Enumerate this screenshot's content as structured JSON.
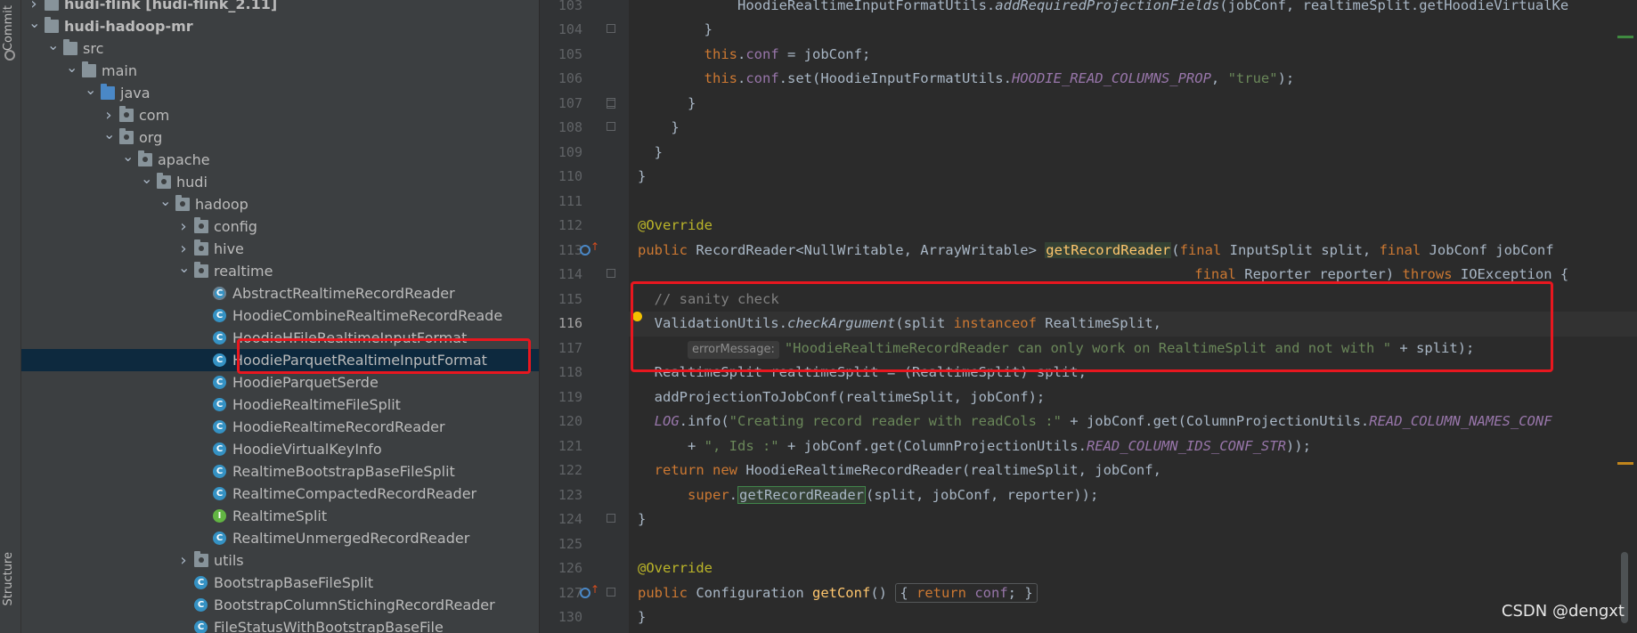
{
  "toolstrip": {
    "commit_label": "Commit",
    "structure_label": "Structure"
  },
  "tree": {
    "rows": [
      {
        "label": "hudi-flink [hudi-flink_2.11]",
        "kind": "module",
        "depth": 1,
        "arrow": ">"
      },
      {
        "label": "hudi-hadoop-mr",
        "kind": "module",
        "depth": 1,
        "arrow": "v"
      },
      {
        "label": "src",
        "kind": "folder",
        "depth": 2,
        "arrow": "v"
      },
      {
        "label": "main",
        "kind": "folder",
        "depth": 3,
        "arrow": "v"
      },
      {
        "label": "java",
        "kind": "source",
        "depth": 4,
        "arrow": "v"
      },
      {
        "label": "com",
        "kind": "package",
        "depth": 5,
        "arrow": ">"
      },
      {
        "label": "org",
        "kind": "package",
        "depth": 5,
        "arrow": "v"
      },
      {
        "label": "apache",
        "kind": "package",
        "depth": 6,
        "arrow": "v"
      },
      {
        "label": "hudi",
        "kind": "package",
        "depth": 7,
        "arrow": "v"
      },
      {
        "label": "hadoop",
        "kind": "package",
        "depth": 8,
        "arrow": "v"
      },
      {
        "label": "config",
        "kind": "package",
        "depth": 9,
        "arrow": ">"
      },
      {
        "label": "hive",
        "kind": "package",
        "depth": 9,
        "arrow": ">"
      },
      {
        "label": "realtime",
        "kind": "package",
        "depth": 9,
        "arrow": "v"
      },
      {
        "label": "AbstractRealtimeRecordReader",
        "kind": "abstract",
        "depth": 10,
        "arrow": ""
      },
      {
        "label": "HoodieCombineRealtimeRecordReade",
        "kind": "class",
        "depth": 10,
        "arrow": ""
      },
      {
        "label": "HoodieHFileRealtimeInputFormat",
        "kind": "class",
        "depth": 10,
        "arrow": ""
      },
      {
        "label": "HoodieParquetRealtimeInputFormat",
        "kind": "class",
        "depth": 10,
        "arrow": "",
        "selected": true
      },
      {
        "label": "HoodieParquetSerde",
        "kind": "class",
        "depth": 10,
        "arrow": ""
      },
      {
        "label": "HoodieRealtimeFileSplit",
        "kind": "class",
        "depth": 10,
        "arrow": ""
      },
      {
        "label": "HoodieRealtimeRecordReader",
        "kind": "class",
        "depth": 10,
        "arrow": ""
      },
      {
        "label": "HoodieVirtualKeyInfo",
        "kind": "class",
        "depth": 10,
        "arrow": ""
      },
      {
        "label": "RealtimeBootstrapBaseFileSplit",
        "kind": "class",
        "depth": 10,
        "arrow": ""
      },
      {
        "label": "RealtimeCompactedRecordReader",
        "kind": "class",
        "depth": 10,
        "arrow": ""
      },
      {
        "label": "RealtimeSplit",
        "kind": "interface",
        "depth": 10,
        "arrow": ""
      },
      {
        "label": "RealtimeUnmergedRecordReader",
        "kind": "class",
        "depth": 10,
        "arrow": ""
      },
      {
        "label": "utils",
        "kind": "package",
        "depth": 9,
        "arrow": ">"
      },
      {
        "label": "BootstrapBaseFileSplit",
        "kind": "class",
        "depth": 9,
        "arrow": ""
      },
      {
        "label": "BootstrapColumnStichingRecordReader",
        "kind": "class",
        "depth": 9,
        "arrow": ""
      },
      {
        "label": "FileStatusWithBootstrapBaseFile",
        "kind": "class",
        "depth": 9,
        "arrow": ""
      }
    ],
    "class_letter": "C",
    "interface_letter": "I"
  },
  "editor": {
    "current_line": "116",
    "lines": [
      {
        "n": "103",
        "html": "            HoodieRealtimeInputFormatUtils.<span class=\"ital\">addRequiredProjectionFields</span>(jobConf, realtimeSplit.getHoodieVirtualKe"
      },
      {
        "n": "104",
        "html": "        }"
      },
      {
        "n": "105",
        "html": "        <span class=\"kw\">this</span>.<span class=\"fld\">conf</span> = jobConf;"
      },
      {
        "n": "106",
        "html": "        <span class=\"kw\">this</span>.<span class=\"fld\">conf</span>.set(HoodieInputFormatUtils.<span class=\"stat\">HOODIE_READ_COLUMNS_PROP</span>, <span class=\"str\">\"true\"</span>);"
      },
      {
        "n": "107",
        "html": "      }"
      },
      {
        "n": "108",
        "html": "    }"
      },
      {
        "n": "109",
        "html": "  }"
      },
      {
        "n": "110",
        "html": "}"
      },
      {
        "n": "111",
        "html": ""
      },
      {
        "n": "112",
        "html": "<span class=\"ann\">@Override</span>"
      },
      {
        "n": "113",
        "html": "<span class=\"kw\">public</span> RecordReader&lt;NullWritable, ArrayWritable&gt; <span class=\"meth meth-hl2\">getRecordReader</span>(<span class=\"kw\">final</span> InputSplit split, <span class=\"kw\">final</span> JobConf jobConf"
      },
      {
        "n": "114",
        "html": "                                                                   <span class=\"kw\">final</span> Reporter reporter) <span class=\"kw\">throws</span> IOException {"
      },
      {
        "n": "115",
        "html": "  <span class=\"cm\">// sanity check</span>"
      },
      {
        "n": "116",
        "html": "  ValidationUtils.<span class=\"ital\">checkArgument</span>(split <span class=\"kw\">instanceof</span> RealtimeSplit,"
      },
      {
        "n": "117",
        "html": "      <span class=\"hint\">errorMessage:</span><span class=\"str\">\"HoodieRealtimeRecordReader can only work on RealtimeSplit and not with \"</span> + split);"
      },
      {
        "n": "118",
        "html": "  RealtimeSplit realtimeSplit = (RealtimeSplit) split;"
      },
      {
        "n": "119",
        "html": "  addProjectionToJobConf(realtimeSplit, jobConf);"
      },
      {
        "n": "120",
        "html": "  <span class=\"stat\">LOG</span>.info(<span class=\"str\">\"Creating record reader with readCols :\"</span> + jobConf.get(ColumnProjectionUtils.<span class=\"stat\">READ_COLUMN_NAMES_CONF</span>"
      },
      {
        "n": "121",
        "html": "      + <span class=\"str\">\", Ids :\"</span> + jobConf.get(ColumnProjectionUtils.<span class=\"stat\">READ_COLUMN_IDS_CONF_STR</span>));"
      },
      {
        "n": "122",
        "html": "  <span class=\"kw\">return new</span> HoodieRealtimeRecordReader(realtimeSplit, jobConf,"
      },
      {
        "n": "123",
        "html": "      <span class=\"kw\">super</span>.<span class=\"meth-hl\">getRecordReader</span>(split, jobConf, reporter));"
      },
      {
        "n": "124",
        "html": "}"
      },
      {
        "n": "125",
        "html": ""
      },
      {
        "n": "126",
        "html": "<span class=\"ann\">@Override</span>"
      },
      {
        "n": "127",
        "html": "<span class=\"kw\">public</span> Configuration <span class=\"meth\">getConf</span>() <span class=\"fold-inline\">{ <span class=\"kw\">return</span> <span class=\"fld\">conf</span>; }</span>"
      },
      {
        "n": "130",
        "html": "}"
      }
    ]
  },
  "watermark": "CSDN @dengxt",
  "colors": {
    "highlight_box": "#e8171f",
    "selected_row": "#0d293e",
    "editor_bg": "#2b2b2b",
    "panel_bg": "#3c3f41"
  }
}
